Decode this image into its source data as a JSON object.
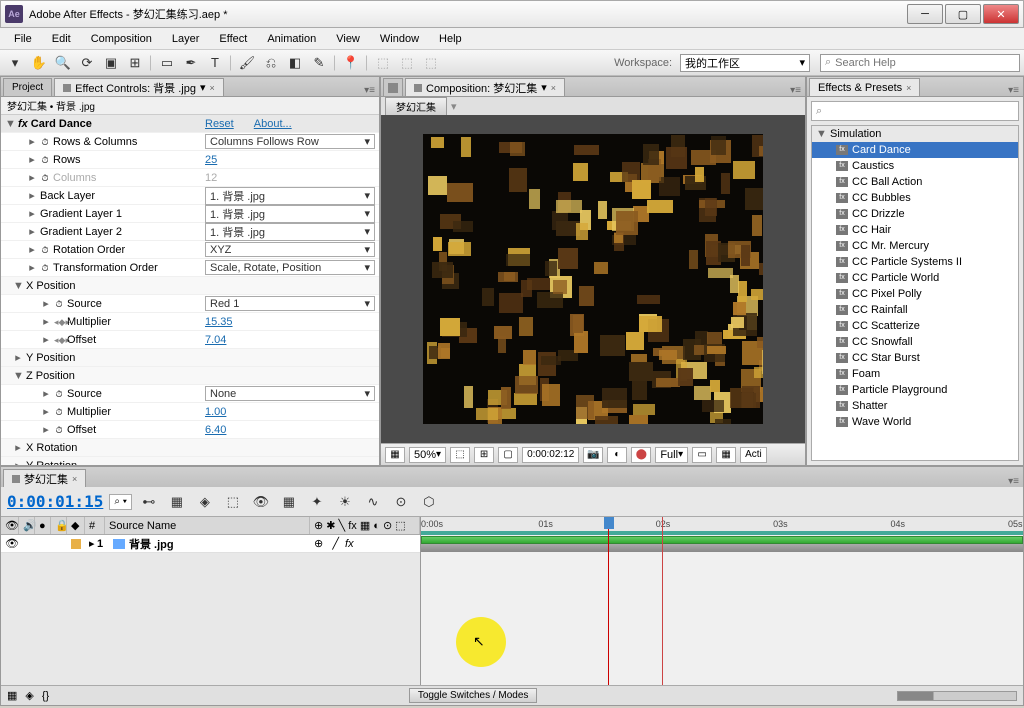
{
  "app": {
    "title": "Adobe After Effects - 梦幻汇集练习.aep *",
    "icon": "Ae"
  },
  "menu": [
    "File",
    "Edit",
    "Composition",
    "Layer",
    "Effect",
    "Animation",
    "View",
    "Window",
    "Help"
  ],
  "toolbar": {
    "workspace_label": "Workspace:",
    "workspace_value": "我的工作区",
    "search_placeholder": "Search Help"
  },
  "left_panel": {
    "tabs": [
      "Project",
      "Effect Controls: 背景 .jpg"
    ],
    "breadcrumb": "梦幻汇集 • 背景 .jpg",
    "effect": {
      "name": "Card Dance",
      "reset": "Reset",
      "about": "About...",
      "rows": [
        {
          "label": "Rows & Columns",
          "value": "Columns Follows Row",
          "type": "dd",
          "indent": 1,
          "stopwatch": true
        },
        {
          "label": "Rows",
          "value": "25",
          "type": "link",
          "indent": 1,
          "stopwatch": true
        },
        {
          "label": "Columns",
          "value": "12",
          "type": "gray",
          "indent": 1,
          "stopwatch": true,
          "disabled": true
        },
        {
          "label": "Back Layer",
          "value": "1. 背景 .jpg",
          "type": "dd",
          "indent": 1
        },
        {
          "label": "Gradient Layer 1",
          "value": "1. 背景 .jpg",
          "type": "dd",
          "indent": 1
        },
        {
          "label": "Gradient Layer 2",
          "value": "1. 背景 .jpg",
          "type": "dd",
          "indent": 1
        },
        {
          "label": "Rotation Order",
          "value": "XYZ",
          "type": "dd",
          "indent": 1,
          "stopwatch": true
        },
        {
          "label": "Transformation Order",
          "value": "Scale, Rotate, Position",
          "type": "dd",
          "indent": 1,
          "stopwatch": true
        },
        {
          "label": "X Position",
          "type": "group",
          "indent": 0
        },
        {
          "label": "Source",
          "value": "Red 1",
          "type": "dd",
          "indent": 2,
          "stopwatch": true
        },
        {
          "label": "Multiplier",
          "value": "15.35",
          "type": "link",
          "indent": 2,
          "stopwatch": true,
          "key": true
        },
        {
          "label": "Offset",
          "value": "7.04",
          "type": "link",
          "indent": 2,
          "stopwatch": true,
          "key": true
        },
        {
          "label": "Y Position",
          "type": "group",
          "indent": 0,
          "collapsed": true
        },
        {
          "label": "Z Position",
          "type": "group",
          "indent": 0
        },
        {
          "label": "Source",
          "value": "None",
          "type": "dd",
          "indent": 2,
          "stopwatch": true
        },
        {
          "label": "Multiplier",
          "value": "1.00",
          "type": "link",
          "indent": 2,
          "stopwatch": true
        },
        {
          "label": "Offset",
          "value": "6.40",
          "type": "link",
          "indent": 2,
          "stopwatch": true
        },
        {
          "label": "X Rotation",
          "type": "group",
          "indent": 0,
          "collapsed": true
        },
        {
          "label": "Y Rotation",
          "type": "group",
          "indent": 0,
          "collapsed": true
        }
      ]
    }
  },
  "comp_panel": {
    "tab": "Composition: 梦幻汇集",
    "btn": "梦幻汇集",
    "zoom": "50%",
    "time": "0:00:02:12",
    "res": "Full",
    "view": "Acti"
  },
  "effects_panel": {
    "title": "Effects & Presets",
    "category": "Simulation",
    "items": [
      "Card Dance",
      "Caustics",
      "CC Ball Action",
      "CC Bubbles",
      "CC Drizzle",
      "CC Hair",
      "CC Mr. Mercury",
      "CC Particle Systems II",
      "CC Particle World",
      "CC Pixel Polly",
      "CC Rainfall",
      "CC Scatterize",
      "CC Snowfall",
      "CC Star Burst",
      "Foam",
      "Particle Playground",
      "Shatter",
      "Wave World"
    ],
    "selected": "Card Dance"
  },
  "timeline": {
    "tab": "梦幻汇集",
    "timecode": "0:00:01:15",
    "header": {
      "source": "Source Name",
      "num": "#"
    },
    "ticks": [
      "0:00s",
      "01s",
      "02s",
      "03s",
      "04s",
      "05s"
    ],
    "layers": [
      {
        "num": "1",
        "name": "背景 .jpg"
      }
    ],
    "toggle": "Toggle Switches / Modes"
  }
}
